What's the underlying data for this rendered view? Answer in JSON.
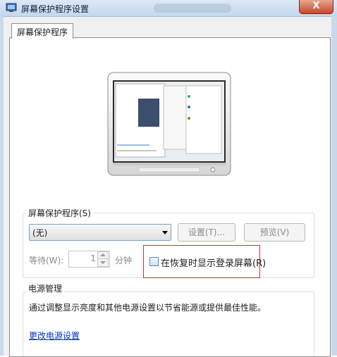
{
  "window": {
    "title": "屏幕保护程序设置",
    "close_glyph": "X"
  },
  "tab": {
    "label": "屏幕保护程序"
  },
  "screensaver": {
    "group_label": "屏幕保护程序(S)",
    "selected": "(无)",
    "settings_button": "设置(T)...",
    "preview_button": "预览(V)",
    "wait_label": "等待(W):",
    "wait_value": "1",
    "minutes_label": "分钟",
    "resume_checkbox_label": "在恢复时显示登录屏幕(R)",
    "resume_checked": false
  },
  "power": {
    "group_label": "电源管理",
    "description": "通过调整显示亮度和其他电源设置以节省能源或提供最佳性能。",
    "link": "更改电源设置"
  },
  "colors": {
    "highlight_border": "#e0282b",
    "link": "#0033cc"
  }
}
